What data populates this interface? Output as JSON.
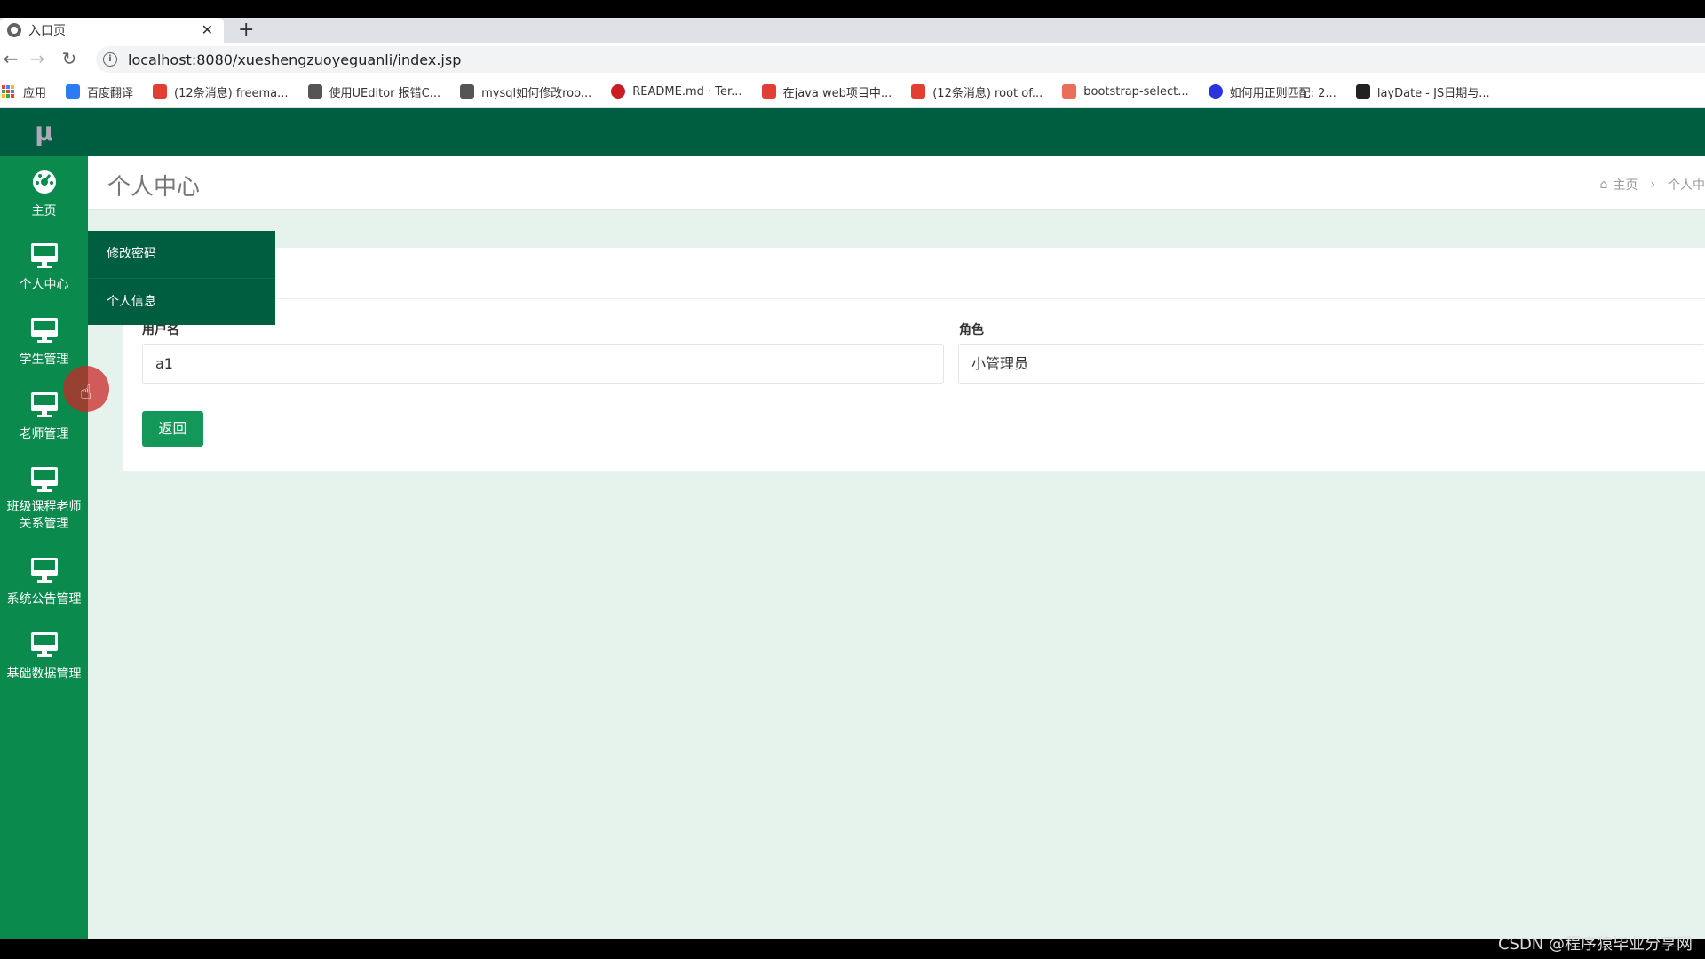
{
  "browser": {
    "tab_title": "入口页",
    "close_glyph": "✕",
    "new_tab_glyph": "+",
    "url": "localhost:8080/xueshengzuoyeguanli/index.jsp",
    "bookmarks": [
      {
        "label": "应用",
        "icon": "apps-grid-icon"
      },
      {
        "label": "百度翻译",
        "icon": "translate-icon",
        "color": "#2d7bf4"
      },
      {
        "label": "(12条消息) freema...",
        "icon": "csdn-icon",
        "color": "#e33e33"
      },
      {
        "label": "使用UEditor 报错C...",
        "icon": "yuque-icon",
        "color": "#555555"
      },
      {
        "label": "mysql如何修改roo...",
        "icon": "yuque-icon",
        "color": "#555555"
      },
      {
        "label": "README.md · Ter...",
        "icon": "gitee-icon",
        "color": "#c71d23"
      },
      {
        "label": "在java web项目中...",
        "icon": "csdn-icon",
        "color": "#e33e33"
      },
      {
        "label": "(12条消息) root of...",
        "icon": "csdn-icon",
        "color": "#e33e33"
      },
      {
        "label": "bootstrap-select...",
        "icon": "jianshu-icon",
        "color": "#ea6f5a"
      },
      {
        "label": "如何用正则匹配: 2...",
        "icon": "baidu-icon",
        "color": "#2932e1"
      },
      {
        "label": "layDate - JS日期与...",
        "icon": "layui-icon",
        "color": "#222222"
      }
    ]
  },
  "app": {
    "logo": "μ",
    "sidebar": [
      {
        "label": "主页",
        "icon": "dashboard-icon"
      },
      {
        "label": "个人中心",
        "icon": "monitor-icon"
      },
      {
        "label": "学生管理",
        "icon": "monitor-icon"
      },
      {
        "label": "老师管理",
        "icon": "monitor-icon"
      },
      {
        "label": "班级课程老师关系管理",
        "icon": "monitor-icon"
      },
      {
        "label": "系统公告管理",
        "icon": "monitor-icon"
      },
      {
        "label": "基础数据管理",
        "icon": "monitor-icon"
      }
    ],
    "submenu": [
      "修改密码",
      "个人信息"
    ],
    "page_title": "个人中心",
    "breadcrumb": {
      "home": "主页",
      "current": "个人中"
    },
    "form": {
      "username_label": "用户名",
      "username_value": "a1",
      "role_label": "角色",
      "role_value": "小管理员",
      "back_button": "返回"
    },
    "colors": {
      "sidebar": "#0b8a4e",
      "topbar": "#005e40",
      "button": "#13985a",
      "content_bg": "#e6f2ec"
    }
  },
  "watermark": "CSDN @程序猿毕业分享网"
}
